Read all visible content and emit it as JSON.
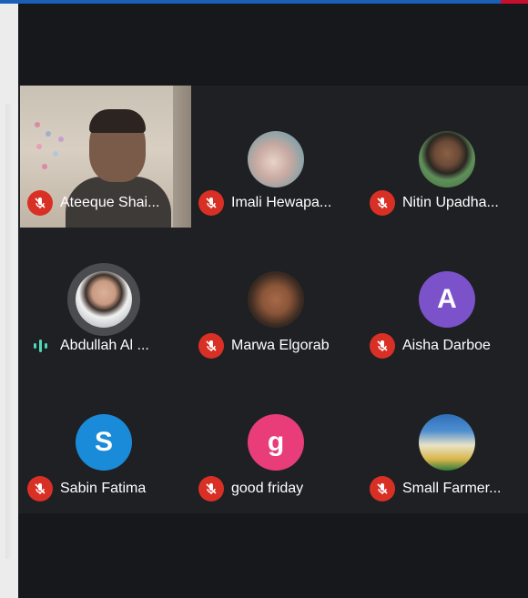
{
  "participants": [
    {
      "name": "Ateeque Shai...",
      "muted": true,
      "kind": "video"
    },
    {
      "name": "Imali Hewapa...",
      "muted": true,
      "kind": "photo"
    },
    {
      "name": "Nitin Upadha...",
      "muted": true,
      "kind": "photo"
    },
    {
      "name": "Abdullah Al ...",
      "muted": false,
      "speaking": true,
      "kind": "photo"
    },
    {
      "name": "Marwa Elgorab",
      "muted": true,
      "kind": "photo"
    },
    {
      "name": "Aisha Darboe",
      "muted": true,
      "kind": "initial",
      "initial": "A",
      "color": "#7b52c9"
    },
    {
      "name": "Sabin Fatima",
      "muted": true,
      "kind": "initial",
      "initial": "S",
      "color": "#1a8bd8"
    },
    {
      "name": "good friday",
      "muted": true,
      "kind": "initial",
      "initial": "g",
      "color": "#e83d78"
    },
    {
      "name": "Small Farmer...",
      "muted": true,
      "kind": "photo"
    }
  ],
  "colors": {
    "muted_mic": "#d93025",
    "speaking": "#4ed8b6",
    "tile_bg": "#1f2023"
  }
}
